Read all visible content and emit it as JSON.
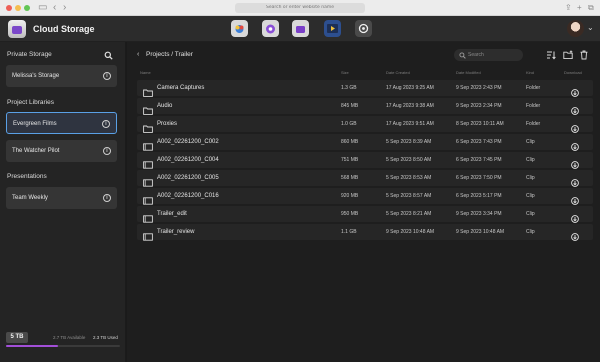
{
  "browser": {
    "url_placeholder": "Search or enter website name"
  },
  "app": {
    "title": "Cloud Storage",
    "toolbar_icons": [
      "resolve-cloud-icon",
      "fusion-cloud-icon",
      "fairlight-cloud-icon",
      "media-icon",
      "settings-icon"
    ],
    "accent_color": "#a24fd8",
    "selection_color": "#5aa0e6"
  },
  "sidebar": {
    "private_title": "Private Storage",
    "private_items": [
      {
        "label": "Melissa's Storage"
      }
    ],
    "libraries_title": "Project Libraries",
    "library_items": [
      {
        "label": "Evergreen Films",
        "selected": true
      },
      {
        "label": "The Watcher Pilot",
        "selected": false
      }
    ],
    "presentations_title": "Presentations",
    "presentation_items": [
      {
        "label": "Team Weekly"
      }
    ],
    "storage": {
      "total": "5 TB",
      "available": "2.7 TB Available",
      "used": "2.3 TB Used",
      "used_fraction": 0.46
    }
  },
  "main": {
    "breadcrumb": "Projects / Trailer",
    "search_placeholder": "Search",
    "columns": [
      "Name",
      "Size",
      "Date Created",
      "Date Modified",
      "Kind",
      "Download"
    ],
    "rows": [
      {
        "name": "Camera Captures",
        "size": "1.3 GB",
        "created": "17 Aug 2023 9:25 AM",
        "modified": "9 Sep 2023 2:43 PM",
        "kind": "Folder",
        "icon": "folder-icon"
      },
      {
        "name": "Audio",
        "size": "845 MB",
        "created": "17 Aug 2023 9:38 AM",
        "modified": "9 Sep 2023 2:34 PM",
        "kind": "Folder",
        "icon": "folder-icon"
      },
      {
        "name": "Proxies",
        "size": "1.0 GB",
        "created": "17 Aug 2023 9:51 AM",
        "modified": "8 Sep 2023 10:11 AM",
        "kind": "Folder",
        "icon": "folder-icon"
      },
      {
        "name": "A002_02261200_C002",
        "size": "860 MB",
        "created": "5 Sep 2023 8:39 AM",
        "modified": "6 Sep 2023 7:43 PM",
        "kind": "Clip",
        "icon": "clip-icon"
      },
      {
        "name": "A002_02261200_C004",
        "size": "751 MB",
        "created": "5 Sep 2023 8:50 AM",
        "modified": "6 Sep 2023 7:45 PM",
        "kind": "Clip",
        "icon": "clip-icon"
      },
      {
        "name": "A002_02261200_C005",
        "size": "568 MB",
        "created": "5 Sep 2023 8:53 AM",
        "modified": "6 Sep 2023 7:50 PM",
        "kind": "Clip",
        "icon": "clip-icon"
      },
      {
        "name": "A002_02261200_C016",
        "size": "920 MB",
        "created": "5 Sep 2023 8:57 AM",
        "modified": "6 Sep 2023 5:17 PM",
        "kind": "Clip",
        "icon": "clip-icon"
      },
      {
        "name": "Trailer_edit",
        "size": "950 MB",
        "created": "5 Sep 2023 8:21 AM",
        "modified": "9 Sep 2023 3:34 PM",
        "kind": "Clip",
        "icon": "clip-icon"
      },
      {
        "name": "Trailer_review",
        "size": "1.1 GB",
        "created": "9 Sep 2023 10:48 AM",
        "modified": "9 Sep 2023 10:48 AM",
        "kind": "Clip",
        "icon": "clip-icon"
      }
    ]
  }
}
